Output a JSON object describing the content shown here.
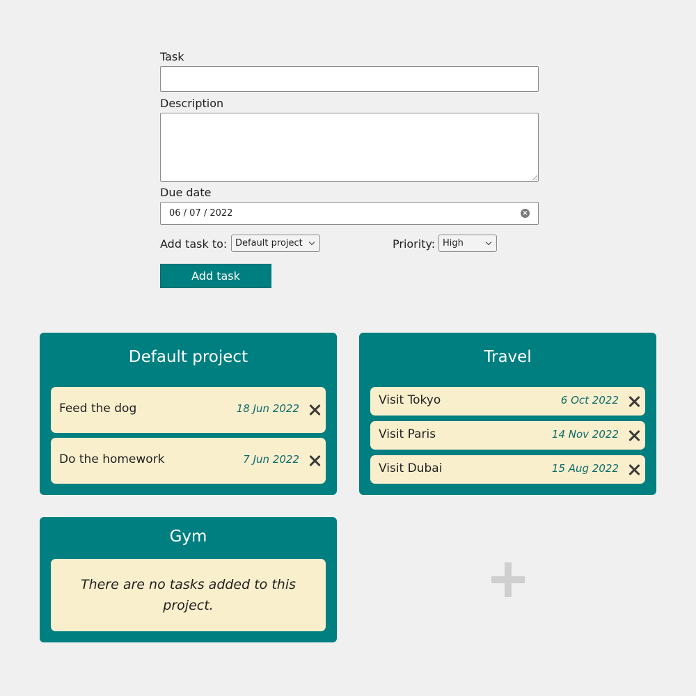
{
  "form": {
    "task_label": "Task",
    "task_value": "",
    "description_label": "Description",
    "description_value": "",
    "due_label": "Due date",
    "due_value": "06 / 07 / 2022",
    "add_to_label": "Add task to:",
    "project_selected": "Default project",
    "priority_label": "Priority:",
    "priority_selected": "High",
    "submit_label": "Add task"
  },
  "projects": [
    {
      "title": "Default project",
      "tasks": [
        {
          "name": "Feed the dog",
          "date": "18 Jun 2022"
        },
        {
          "name": "Do the homework",
          "date": "7 Jun 2022"
        }
      ]
    },
    {
      "title": "Travel",
      "tasks": [
        {
          "name": "Visit Tokyo",
          "date": "6 Oct 2022"
        },
        {
          "name": "Visit Paris",
          "date": "14 Nov 2022"
        },
        {
          "name": "Visit Dubai",
          "date": "15 Aug 2022"
        }
      ]
    },
    {
      "title": "Gym",
      "empty_message": "There are no tasks added to this project."
    }
  ],
  "colors": {
    "card": "#007f80",
    "task_bg": "#faefcd",
    "date_text": "#0d6b6c",
    "background": "#f0f0f0"
  },
  "icons": {
    "delete": "close-icon",
    "add_project": "plus-icon",
    "clear_date": "clear-icon",
    "dropdown": "chevron-down-icon"
  }
}
